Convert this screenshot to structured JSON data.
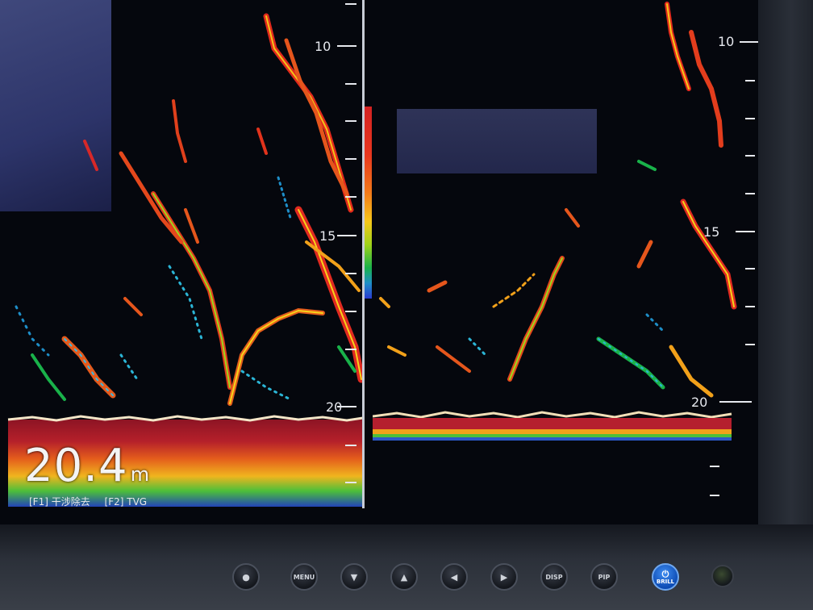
{
  "display": {
    "depth_readout": {
      "value": "20.4",
      "unit": "m"
    },
    "function_keys": [
      "[F1] 干涉除去",
      "[F2] TVG"
    ],
    "left_pane_scale": [
      "10",
      "15",
      "20"
    ],
    "right_pane_scale": [
      "10",
      "15",
      "20"
    ],
    "colors": {
      "strong_echo": "#d32222",
      "medium_echo": "#f2a11a",
      "weak_echo": "#1e8ec8",
      "background": "#05070d"
    }
  },
  "panel_buttons": [
    {
      "label": "",
      "icon": "round-icon"
    },
    {
      "label": "MENU",
      "icon": ""
    },
    {
      "label": "",
      "icon": "down-triangle-icon"
    },
    {
      "label": "",
      "icon": "up-triangle-icon"
    },
    {
      "label": "",
      "icon": "left-triangle-icon"
    },
    {
      "label": "",
      "icon": "right-triangle-icon"
    },
    {
      "label": "DISP",
      "icon": ""
    },
    {
      "label": "PIP",
      "icon": ""
    },
    {
      "label": "BRILL",
      "icon": "power-icon"
    }
  ]
}
